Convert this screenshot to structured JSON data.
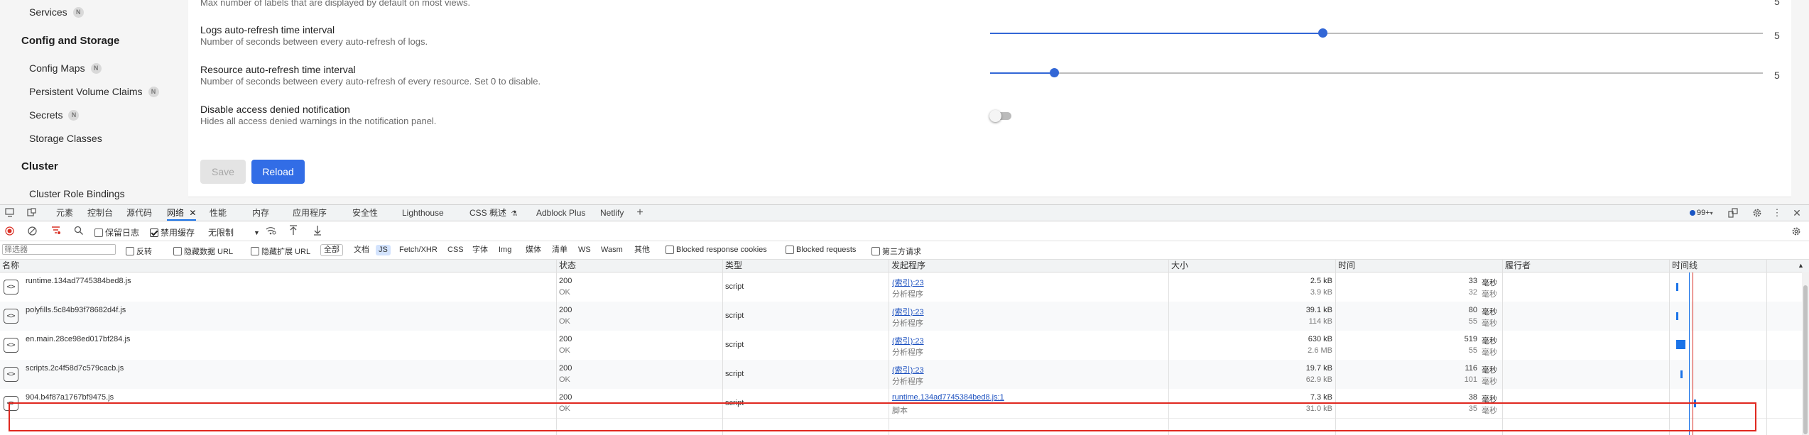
{
  "sidebar": {
    "items": [
      {
        "label": "Services",
        "badge": "N"
      },
      {
        "label": "Config Maps",
        "badge": "N"
      },
      {
        "label": "Persistent Volume Claims",
        "badge": "N"
      },
      {
        "label": "Secrets",
        "badge": "N"
      },
      {
        "label": "Storage Classes",
        "badge": ""
      },
      {
        "label": "Cluster Role Bindings",
        "badge": ""
      }
    ],
    "sections": [
      "Config and Storage",
      "Cluster"
    ]
  },
  "settings": {
    "top_desc": "Max number of labels that are displayed by default on most views.",
    "top_value": "5",
    "logs_title": "Logs auto-refresh time interval",
    "logs_desc": "Number of seconds between every auto-refresh of logs.",
    "logs_value": "5",
    "logs_fraction": 0.43,
    "resource_title": "Resource auto-refresh time interval",
    "resource_desc": "Number of seconds between every auto-refresh of every resource. Set 0 to disable.",
    "resource_value": "5",
    "resource_fraction": 0.083,
    "denied_title": "Disable access denied notification",
    "denied_desc": "Hides all access denied warnings in the notification panel.",
    "denied_enabled": false,
    "save_label": "Save",
    "reload_label": "Reload",
    "accent": "#3367d6"
  },
  "devtools": {
    "tabs": [
      "元素",
      "控制台",
      "源代码",
      "网络",
      "性能",
      "内存",
      "应用程序",
      "安全性",
      "Lighthouse",
      "CSS 概述",
      "Adblock Plus",
      "Netlify"
    ],
    "active_tab": "网络",
    "issues_count": "99+",
    "toolbar": {
      "preserve_log": "保留日志",
      "disable_cache": "禁用缓存",
      "throttle": "无限制"
    },
    "filter": {
      "placeholder": "筛选器",
      "invert": "反转",
      "hide_data_urls": "隐藏数据 URL",
      "hide_ext_urls": "隐藏扩展 URL",
      "types": [
        "全部",
        "文档",
        "JS",
        "Fetch/XHR",
        "CSS",
        "字体",
        "Img",
        "媒体",
        "清单",
        "WS",
        "Wasm",
        "其他"
      ],
      "selected_type": "JS",
      "blocked_cookies": "Blocked response cookies",
      "blocked_requests": "Blocked requests",
      "third_party": "第三方请求"
    },
    "columns": [
      "名称",
      "状态",
      "类型",
      "发起程序",
      "大小",
      "时间",
      "履行者",
      "时间线"
    ],
    "rows": [
      {
        "name": "runtime.134ad7745384bed8.js",
        "status": "200",
        "status_text": "OK",
        "type": "script",
        "initiator": "(索引):23",
        "initiator_sub": "分析程序",
        "size": "2.5 kB",
        "size_sub": "3.9 kB",
        "time": "33",
        "time_sub": "32",
        "unit": "毫秒"
      },
      {
        "name": "polyfills.5c84b93f78682d4f.js",
        "status": "200",
        "status_text": "OK",
        "type": "script",
        "initiator": "(索引):23",
        "initiator_sub": "分析程序",
        "size": "39.1 kB",
        "size_sub": "114 kB",
        "time": "80",
        "time_sub": "55",
        "unit": "毫秒"
      },
      {
        "name": "en.main.28ce98ed017bf284.js",
        "status": "200",
        "status_text": "OK",
        "type": "script",
        "initiator": "(索引):23",
        "initiator_sub": "分析程序",
        "size": "630 kB",
        "size_sub": "2.6 MB",
        "time": "519",
        "time_sub": "55",
        "unit": "毫秒"
      },
      {
        "name": "scripts.2c4f58d7c579cacb.js",
        "status": "200",
        "status_text": "OK",
        "type": "script",
        "initiator": "(索引):23",
        "initiator_sub": "分析程序",
        "size": "19.7 kB",
        "size_sub": "62.9 kB",
        "time": "116",
        "time_sub": "101",
        "unit": "毫秒"
      },
      {
        "name": "904.b4f87a1767bf9475.js",
        "status": "200",
        "status_text": "OK",
        "type": "script",
        "initiator": "runtime.134ad7745384bed8.js:1",
        "initiator_sub": "脚本",
        "size": "7.3 kB",
        "size_sub": "31.0 kB",
        "time": "38",
        "time_sub": "35",
        "unit": "毫秒"
      }
    ],
    "highlight_color": "#e0281f"
  }
}
